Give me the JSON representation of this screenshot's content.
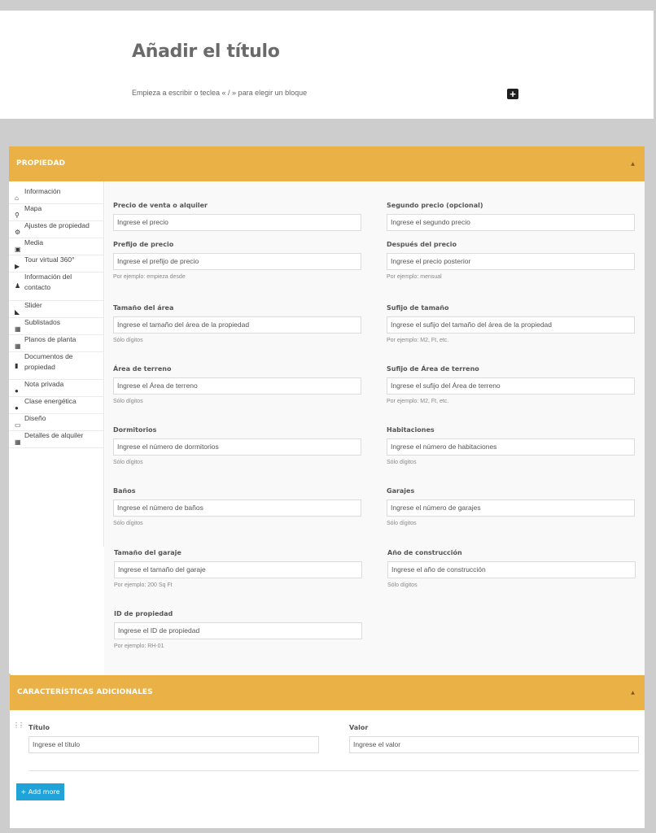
{
  "editor": {
    "title": "Añadir el título",
    "block_hint": "Empieza a escribir o teclea « / » para elegir un bloque",
    "add_block": "+"
  },
  "propiedad": {
    "heading": "PROPIEDAD",
    "toggle": "▲",
    "sidebar": [
      {
        "label": "Información",
        "icon": "home-icon",
        "glyph": "⌂"
      },
      {
        "label": "Mapa",
        "icon": "map-pin-icon",
        "glyph": "⚲"
      },
      {
        "label": "Ajustes de propiedad",
        "icon": "gear-icon",
        "glyph": "⚙"
      },
      {
        "label": "Media",
        "icon": "image-icon",
        "glyph": "▣"
      },
      {
        "label": "Tour virtual 360°",
        "icon": "video-icon",
        "glyph": "▶"
      },
      {
        "label": "Información del contacto",
        "icon": "user-icon",
        "glyph": "♟"
      },
      {
        "label": "Slider",
        "icon": "slider-icon",
        "glyph": "◣"
      },
      {
        "label": "Sublistados",
        "icon": "grid-icon",
        "glyph": "▦"
      },
      {
        "label": "Planos de planta",
        "icon": "grid-icon",
        "glyph": "▦"
      },
      {
        "label": "Documentos de propiedad",
        "icon": "document-icon",
        "glyph": "▮"
      },
      {
        "label": "Nota privada",
        "icon": "bulb-icon",
        "glyph": "●"
      },
      {
        "label": "Clase energética",
        "icon": "bulb-icon",
        "glyph": "●"
      },
      {
        "label": "Diseño",
        "icon": "layout-icon",
        "glyph": "▭"
      },
      {
        "label": "Detalles de alquiler",
        "icon": "grid-icon",
        "glyph": "▦"
      }
    ],
    "fields": [
      {
        "label": "Precio de venta o alquiler",
        "placeholder": "Ingrese el precio",
        "help": ""
      },
      {
        "label": "Segundo precio (opcional)",
        "placeholder": "Ingrese el segundo precio",
        "help": ""
      },
      {
        "label": "Prefijo de precio",
        "placeholder": "Ingrese el prefijo de precio",
        "help": "Por ejemplo: empieza desde"
      },
      {
        "label": "Después del precio",
        "placeholder": "Ingrese el precio posterior",
        "help": "Por ejemplo: mensual"
      },
      {
        "label": "Tamaño del área",
        "placeholder": "Ingrese el tamaño del área de la propiedad",
        "help": "Sólo dígitos"
      },
      {
        "label": "Sufijo de tamaño",
        "placeholder": "Ingrese el sufijo del tamaño del área de la propiedad",
        "help": "Por ejemplo: M2, Ft, etc."
      },
      {
        "label": "Área de terreno",
        "placeholder": "Ingrese el Área de terreno",
        "help": "Sólo dígitos"
      },
      {
        "label": "Sufijo de Área de terreno",
        "placeholder": "Ingrese el sufijo del Área de terreno",
        "help": "Por ejemplo: M2, Ft, etc."
      },
      {
        "label": "Dormitorios",
        "placeholder": "Ingrese el número de dormitorios",
        "help": "Sólo dígitos"
      },
      {
        "label": "Habitaciones",
        "placeholder": "Ingrese el número de habitaciones",
        "help": "Sólo dígitos"
      },
      {
        "label": "Baños",
        "placeholder": "Ingrese el número de baños",
        "help": "Sólo dígitos"
      },
      {
        "label": "Garajes",
        "placeholder": "Ingrese el número de garajes",
        "help": "Sólo dígitos"
      },
      {
        "label": "Tamaño del garaje",
        "placeholder": "Ingrese el tamaño del garaje",
        "help": "Por ejemplo: 200 Sq Ft"
      },
      {
        "label": "Año de construcción",
        "placeholder": "Ingrese el año de construcción",
        "help": "Sólo dígitos"
      },
      {
        "label": "ID de propiedad",
        "placeholder": "Ingrese el ID de propiedad",
        "help": "Por ejemplo: RH-01"
      }
    ]
  },
  "caracteristicas": {
    "heading": "CARACTERÍSTICAS ADICIONALES",
    "toggle": "▲",
    "drag": "⋮⋮",
    "title_label": "Título",
    "title_placeholder": "Ingrese el título",
    "value_label": "Valor",
    "value_placeholder": "Ingrese el valor",
    "add_more": "+ Add more"
  },
  "colors": {
    "accent": "#eab246",
    "button": "#1fa3d8"
  }
}
